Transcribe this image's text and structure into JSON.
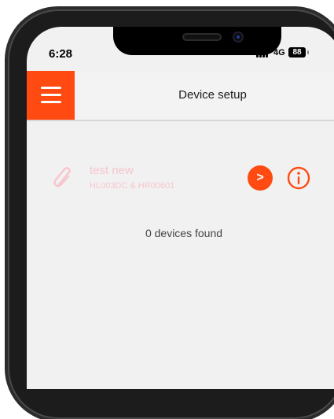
{
  "status_bar": {
    "time": "6:28",
    "network": "4G",
    "battery": "88"
  },
  "header": {
    "title": "Device setup",
    "menu_icon": "hamburger-icon",
    "accent_color": "#ff4b12"
  },
  "devices": [
    {
      "name": "test new",
      "ids": "HL003DC & HR00601",
      "icon": "paperclip-icon",
      "text_color": "#f7c6cf"
    }
  ],
  "go_button_label": ">",
  "info_icon": "info-icon",
  "status": "0 devices found"
}
